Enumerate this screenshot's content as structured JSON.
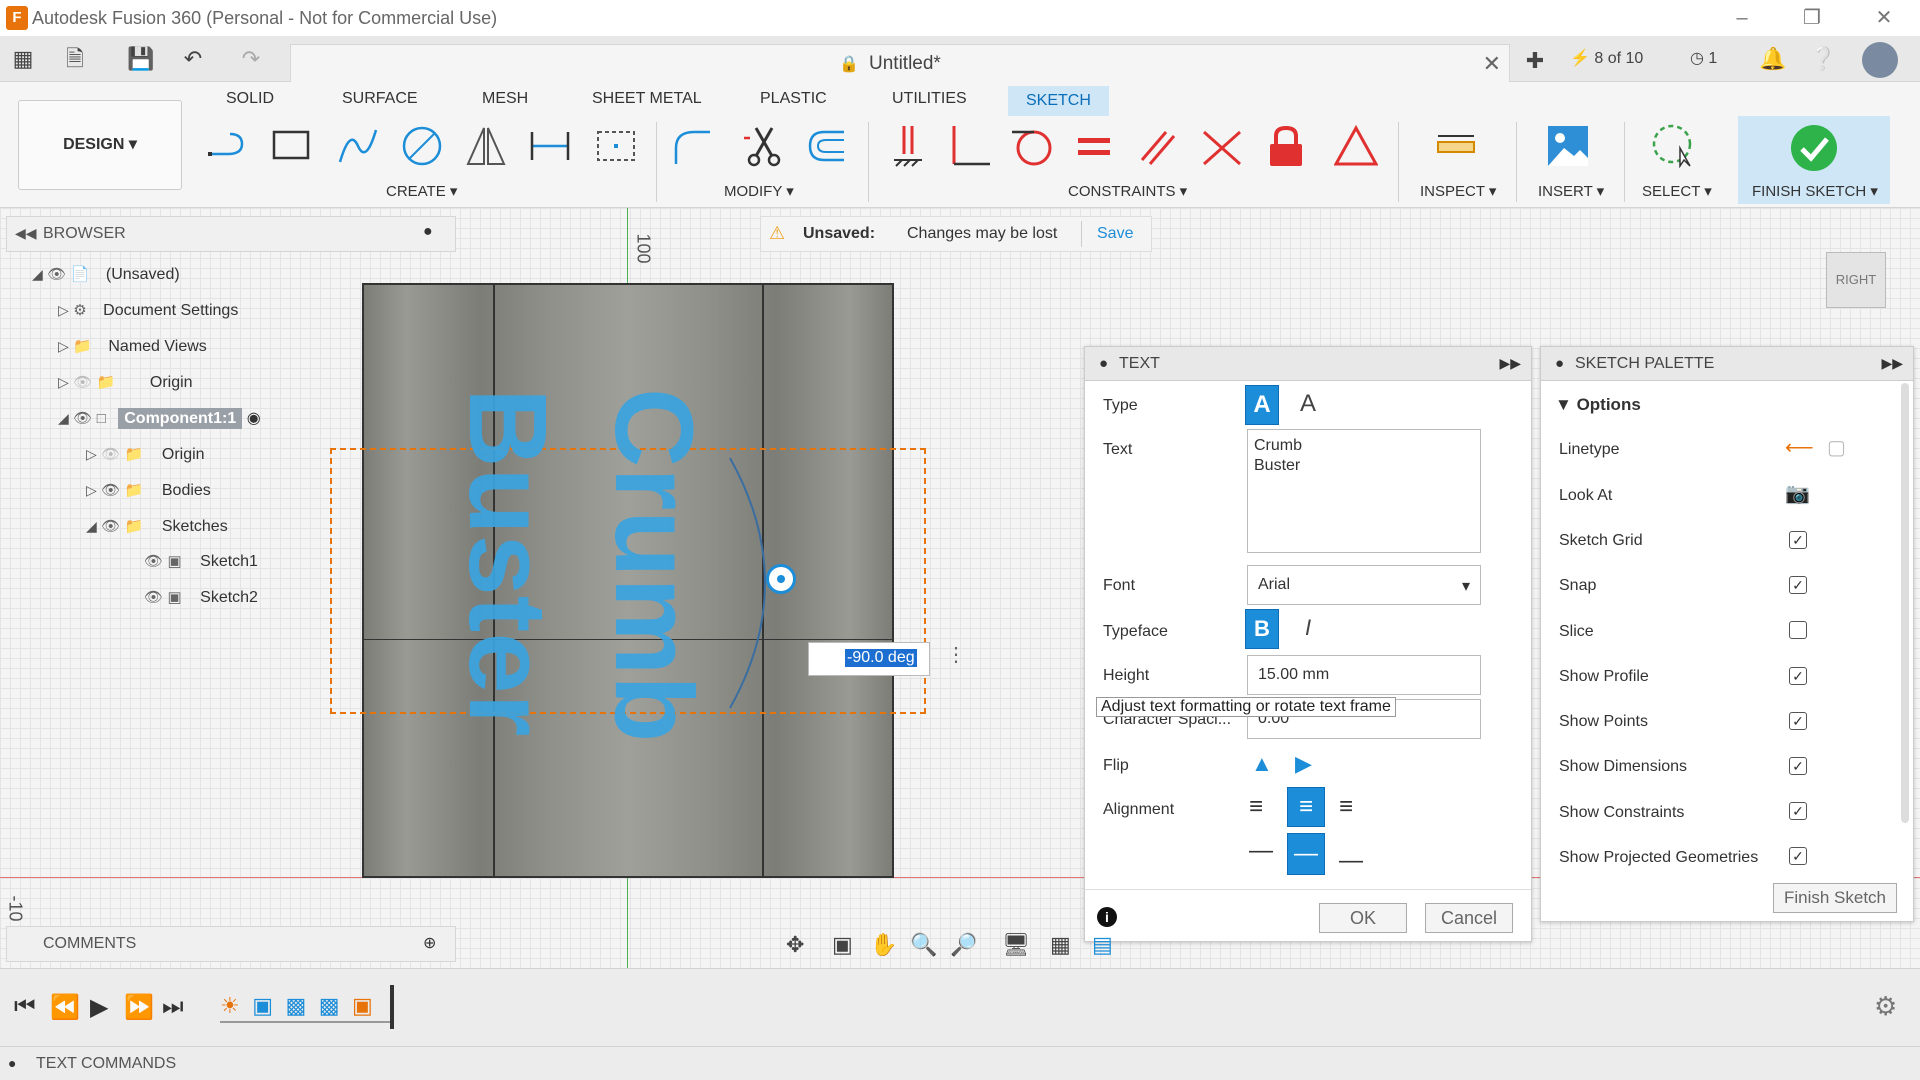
{
  "window": {
    "title": "Autodesk Fusion 360 (Personal - Not for Commercial Use)",
    "logo": "F"
  },
  "doc": {
    "title": "Untitled*",
    "count": "8 of 10",
    "jobs": "1"
  },
  "ribbon_tabs": [
    "SOLID",
    "SURFACE",
    "MESH",
    "SHEET METAL",
    "PLASTIC",
    "UTILITIES",
    "SKETCH"
  ],
  "workspace": "DESIGN ▾",
  "groups": {
    "create": "CREATE ▾",
    "modify": "MODIFY ▾",
    "constraints": "CONSTRAINTS ▾",
    "inspect": "INSPECT ▾",
    "insert": "INSERT ▾",
    "select": "SELECT ▾",
    "finish": "FINISH SKETCH ▾"
  },
  "browser": {
    "title": "BROWSER",
    "root": "(Unsaved)",
    "items": [
      "Document Settings",
      "Named Views",
      "Origin",
      "Component1:1",
      "Origin",
      "Bodies",
      "Sketches",
      "Sketch1",
      "Sketch2"
    ]
  },
  "unsaved": {
    "label": "Unsaved:",
    "message": "Changes may be lost",
    "save": "Save"
  },
  "axis": {
    "top": "100",
    "left": "-10"
  },
  "canvas_text": {
    "line1": "Crumb",
    "line2": "Buster",
    "angle": "-90.0 deg"
  },
  "text_dialog": {
    "title": "TEXT",
    "type_label": "Type",
    "text_label": "Text",
    "text_value": "Crumb\nBuster",
    "font_label": "Font",
    "font_value": "Arial",
    "typeface_label": "Typeface",
    "height_label": "Height",
    "height_value": "15.00 mm",
    "spacing_label": "Character Spaci...",
    "spacing_value": "0.00",
    "flip_label": "Flip",
    "alignment_label": "Alignment",
    "ok": "OK",
    "cancel": "Cancel",
    "tooltip": "Adjust text formatting or rotate text frame"
  },
  "palette": {
    "title": "SKETCH PALETTE",
    "section": "Options",
    "rows": [
      {
        "label": "Linetype"
      },
      {
        "label": "Look At"
      },
      {
        "label": "Sketch Grid",
        "checked": true
      },
      {
        "label": "Snap",
        "checked": true
      },
      {
        "label": "Slice",
        "checked": false
      },
      {
        "label": "Show Profile",
        "checked": true
      },
      {
        "label": "Show Points",
        "checked": true
      },
      {
        "label": "Show Dimensions",
        "checked": true
      },
      {
        "label": "Show Constraints",
        "checked": true
      },
      {
        "label": "Show Projected Geometries",
        "checked": true
      }
    ],
    "finish": "Finish Sketch"
  },
  "viewcube": "RIGHT",
  "comments": "COMMENTS",
  "status": "TEXT COMMANDS",
  "colors": {
    "accent": "#1c8dd8",
    "text_blue": "#3aa4e0",
    "body": "#8a8a84",
    "orange": "#e8730a"
  }
}
